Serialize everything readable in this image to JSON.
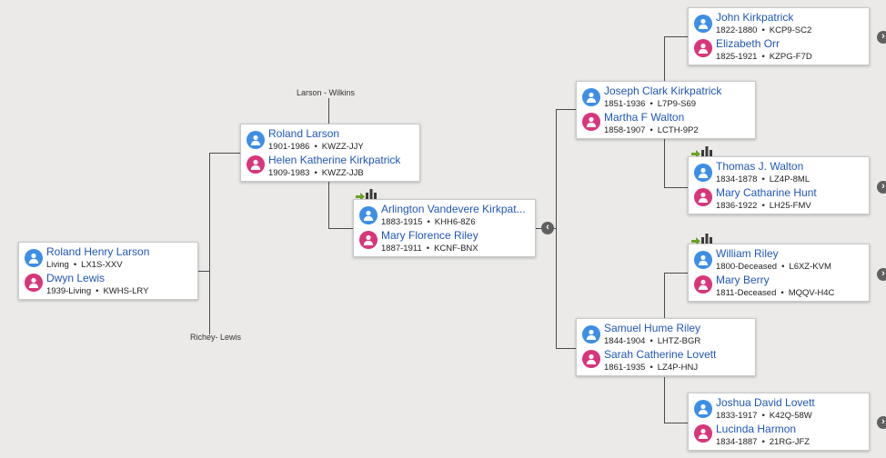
{
  "family_labels": {
    "larson_wilkins": "Larson - Wilkins",
    "richey_lewis": "Richey- Lewis"
  },
  "couples": {
    "root": {
      "husband": {
        "name": "Roland Henry Larson",
        "dates": "Living",
        "pid": "LX1S-XXV"
      },
      "wife": {
        "name": "Dwyn Lewis",
        "dates": "1939-Living",
        "pid": "KWHS-LRY"
      }
    },
    "gen1": {
      "husband": {
        "name": "Roland Larson",
        "dates": "1901-1986",
        "pid": "KWZZ-JJY"
      },
      "wife": {
        "name": "Helen Katherine Kirkpatrick",
        "dates": "1909-1983",
        "pid": "KWZZ-JJB"
      }
    },
    "gen2": {
      "husband": {
        "name": "Arlington Vandevere Kirkpat...",
        "dates": "1883-1915",
        "pid": "KHH6-8Z6"
      },
      "wife": {
        "name": "Mary Florence Riley",
        "dates": "1887-1911",
        "pid": "KCNF-BNX"
      }
    },
    "gen3a": {
      "husband": {
        "name": "Joseph Clark Kirkpatrick",
        "dates": "1851-1936",
        "pid": "L7P9-S69"
      },
      "wife": {
        "name": "Martha F Walton",
        "dates": "1858-1907",
        "pid": "LCTH-9P2"
      }
    },
    "gen3b": {
      "husband": {
        "name": "Samuel Hume Riley",
        "dates": "1844-1904",
        "pid": "LHTZ-BGR"
      },
      "wife": {
        "name": "Sarah Catherine Lovett",
        "dates": "1861-1935",
        "pid": "LZ4P-HNJ"
      }
    },
    "gen4a": {
      "husband": {
        "name": "John Kirkpatrick",
        "dates": "1822-1880",
        "pid": "KCP9-SC2"
      },
      "wife": {
        "name": "Elizabeth Orr",
        "dates": "1825-1921",
        "pid": "KZPG-F7D"
      }
    },
    "gen4b": {
      "husband": {
        "name": "Thomas J. Walton",
        "dates": "1834-1878",
        "pid": "LZ4P-8ML"
      },
      "wife": {
        "name": "Mary Catharine Hunt",
        "dates": "1836-1922",
        "pid": "LH25-FMV"
      }
    },
    "gen4c": {
      "husband": {
        "name": "William Riley",
        "dates": "1800-Deceased",
        "pid": "L6XZ-KVM"
      },
      "wife": {
        "name": "Mary Berry",
        "dates": "1811-Deceased",
        "pid": "MQQV-H4C"
      }
    },
    "gen4d": {
      "husband": {
        "name": "Joshua David Lovett",
        "dates": "1833-1917",
        "pid": "K42Q-58W"
      },
      "wife": {
        "name": "Lucinda Harmon",
        "dates": "1834-1887",
        "pid": "21RG-JFZ"
      }
    }
  },
  "separator": "•",
  "icons": {
    "male": "male-avatar-icon",
    "female": "female-avatar-icon",
    "expand": "chevron-right-icon",
    "collapse": "chevron-left-icon",
    "hint_arrow": "arrow-right-icon",
    "hint_tree": "family-tree-icon"
  },
  "colors": {
    "background": "#ebeae8",
    "name_link": "#1f57b8",
    "male": "#3d8ee6",
    "female": "#d8357a",
    "hint_green": "#6aa324"
  }
}
